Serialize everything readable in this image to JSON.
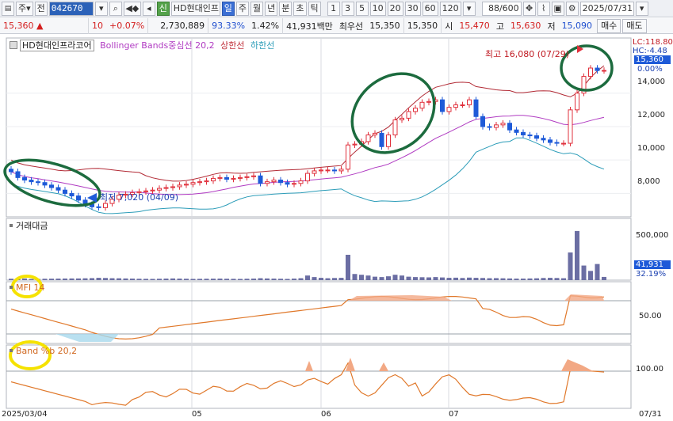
{
  "toolbar": {
    "market_select": "주",
    "market_arrow": "▾",
    "type_select": "전",
    "code": "042670",
    "stock_name": "HD현대인프",
    "period_tabs": [
      "일",
      "주",
      "월",
      "년",
      "분",
      "초",
      "틱"
    ],
    "interval_buttons": [
      "1",
      "3",
      "5",
      "10",
      "20",
      "30",
      "60",
      "120"
    ],
    "count_value": "88",
    "count_total": "/600",
    "date": "2025/07/31",
    "credit_badge": "신"
  },
  "quote": {
    "price": "15,360",
    "change_arrow": "▲",
    "change": "10",
    "change_pct": "+0.07%",
    "volume": "2,730,889",
    "volume_ratio": "93.33%",
    "turnover_rate": "1.42%",
    "trade_value": "41,931백만",
    "best_ask_label": "최우선",
    "best_ask": "15,350",
    "best_bid": "15,350",
    "open_label": "시",
    "open": "15,470",
    "high_label": "고",
    "high": "15,630",
    "low_label": "저",
    "low": "15,090",
    "buy_button": "매수",
    "sell_button": "매도"
  },
  "chart_header": {
    "stock_label": "HD현대인프라코어",
    "indicator_label": "Bollinger Bands중심선 20,2",
    "upper_label": "상한선",
    "lower_label": "하한선"
  },
  "annotations": {
    "high_text": "최고 16,080 (07/29)",
    "low_text": "최저 7,020 (04/09)",
    "lc_label": "LC:118.80",
    "hc_label": "HC:-4.48",
    "last_price": "15,360",
    "pct_label": "0.00%"
  },
  "panels": {
    "volume_title": "거래대금",
    "volume_last": "41,931",
    "volume_pct": "32.19%",
    "mfi_title": "MFI 14",
    "band_title": "Band %b 20,2"
  },
  "x_axis": [
    "2025/03/04",
    "05",
    "06",
    "07",
    "07/31"
  ],
  "price_axis": [
    "14,000",
    "12,000",
    "10,000",
    "8,000"
  ],
  "volume_axis": [
    "500,000"
  ],
  "mfi_axis": [
    "50.00"
  ],
  "band_axis": [
    "100.00"
  ],
  "colors": {
    "up": "#e0303c",
    "down": "#1e5ad8",
    "upper_band": "#b22a35",
    "middle_band": "#b03bc2",
    "lower_band": "#2b9cb8",
    "volume_bar": "#6b6ea3",
    "mfi_line": "#e0782a",
    "band_line": "#e0782a",
    "highlight_green": "#1c6b3e",
    "highlight_yellow": "#f5e200"
  },
  "chart_data": {
    "type": "candlestick",
    "title": "HD현대인프라코어",
    "x_start": "2025/03/04",
    "x_end": "2025/07/31",
    "ylim": [
      6600,
      17300
    ],
    "price_high": 16080,
    "price_low": 7020,
    "last_close": 15360,
    "closes": [
      9300,
      8950,
      8800,
      8700,
      8650,
      8500,
      8350,
      8200,
      8000,
      7850,
      7600,
      7350,
      7200,
      7150,
      7400,
      7650,
      7900,
      7950,
      8050,
      8100,
      8150,
      8200,
      8300,
      8350,
      8400,
      8500,
      8550,
      8650,
      8700,
      8750,
      8900,
      8950,
      8850,
      8900,
      8950,
      9000,
      9050,
      8600,
      8700,
      8800,
      8650,
      8550,
      8600,
      8750,
      9200,
      9350,
      9400,
      9400,
      9350,
      9450,
      10900,
      10950,
      11100,
      11500,
      11600,
      10800,
      11500,
      12400,
      12500,
      12900,
      13100,
      13450,
      13500,
      13600,
      12900,
      13150,
      13300,
      13300,
      13600,
      12600,
      12000,
      11950,
      12100,
      12200,
      11800,
      11650,
      11500,
      11450,
      11300,
      11200,
      11050,
      11000,
      11000,
      13000,
      14000,
      15000,
      15500,
      15350,
      15360
    ],
    "volume": [
      18000,
      20000,
      22000,
      15000,
      16000,
      18000,
      19000,
      20000,
      21000,
      22000,
      22000,
      24000,
      26000,
      30000,
      28000,
      25000,
      24000,
      22000,
      20000,
      18000,
      17000,
      16000,
      18000,
      20000,
      22000,
      20000,
      18000,
      16000,
      17000,
      18000,
      19000,
      20000,
      18000,
      17000,
      16000,
      18000,
      20000,
      25000,
      22000,
      20000,
      18000,
      16000,
      20000,
      25000,
      60000,
      40000,
      30000,
      25000,
      28000,
      30000,
      330000,
      80000,
      70000,
      60000,
      45000,
      40000,
      50000,
      70000,
      60000,
      45000,
      40000,
      38000,
      36000,
      40000,
      35000,
      30000,
      32000,
      28000,
      33000,
      30000,
      28000,
      25000,
      26000,
      24000,
      22000,
      20000,
      20000,
      22000,
      24000,
      28000,
      30000,
      28000,
      25000,
      360000,
      640000,
      190000,
      120000,
      210000,
      41931
    ],
    "mfi": [
      42,
      60,
      82
    ],
    "band_pct_b": [
      100,
      5,
      85
    ]
  }
}
